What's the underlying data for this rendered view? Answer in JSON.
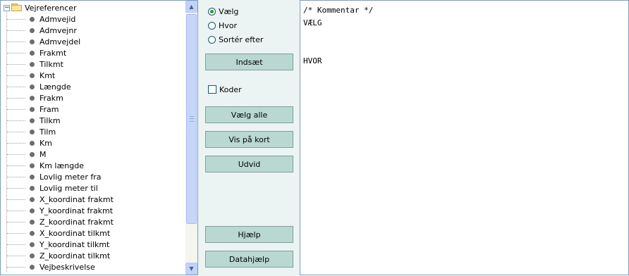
{
  "tree": {
    "root_label": "Vejreferencer",
    "expander_symbol": "−",
    "items": [
      "Admvejid",
      "Admvejnr",
      "Admvejdel",
      "Frakmt",
      "Tilkmt",
      "Kmt",
      "Længde",
      "Frakm",
      "Fram",
      "Tilkm",
      "Tilm",
      "Km",
      "M",
      "Km længde",
      "Lovlig meter fra",
      "Lovlig meter til",
      "X_koordinat frakmt",
      "Y_koordinat frakmt",
      "Z_koordinat frakmt",
      "X_koordinat tilkmt",
      "Y_koordinat tilkmt",
      "Z_koordinat tilkmt",
      "Vejbeskrivelse"
    ]
  },
  "controls": {
    "radios": [
      {
        "label": "Vælg",
        "selected": true
      },
      {
        "label": "Hvor",
        "selected": false
      },
      {
        "label": "Sortér efter",
        "selected": false
      }
    ],
    "insert_label": "Indsæt",
    "codes_label": "Koder",
    "codes_checked": false,
    "select_all_label": "Vælg alle",
    "show_on_map_label": "Vis på kort",
    "expand_label": "Udvid",
    "help_label": "Hjælp",
    "data_help_label": "Datahjælp"
  },
  "editor": {
    "lines": [
      "/* Kommentar */",
      "VÆLG",
      "",
      "",
      "HVOR"
    ]
  },
  "colors": {
    "panel_bg": "#ebf3f3",
    "button_bg": "#b9d8d2",
    "border": "#7f9db9",
    "radio_selected": "#21a121"
  }
}
